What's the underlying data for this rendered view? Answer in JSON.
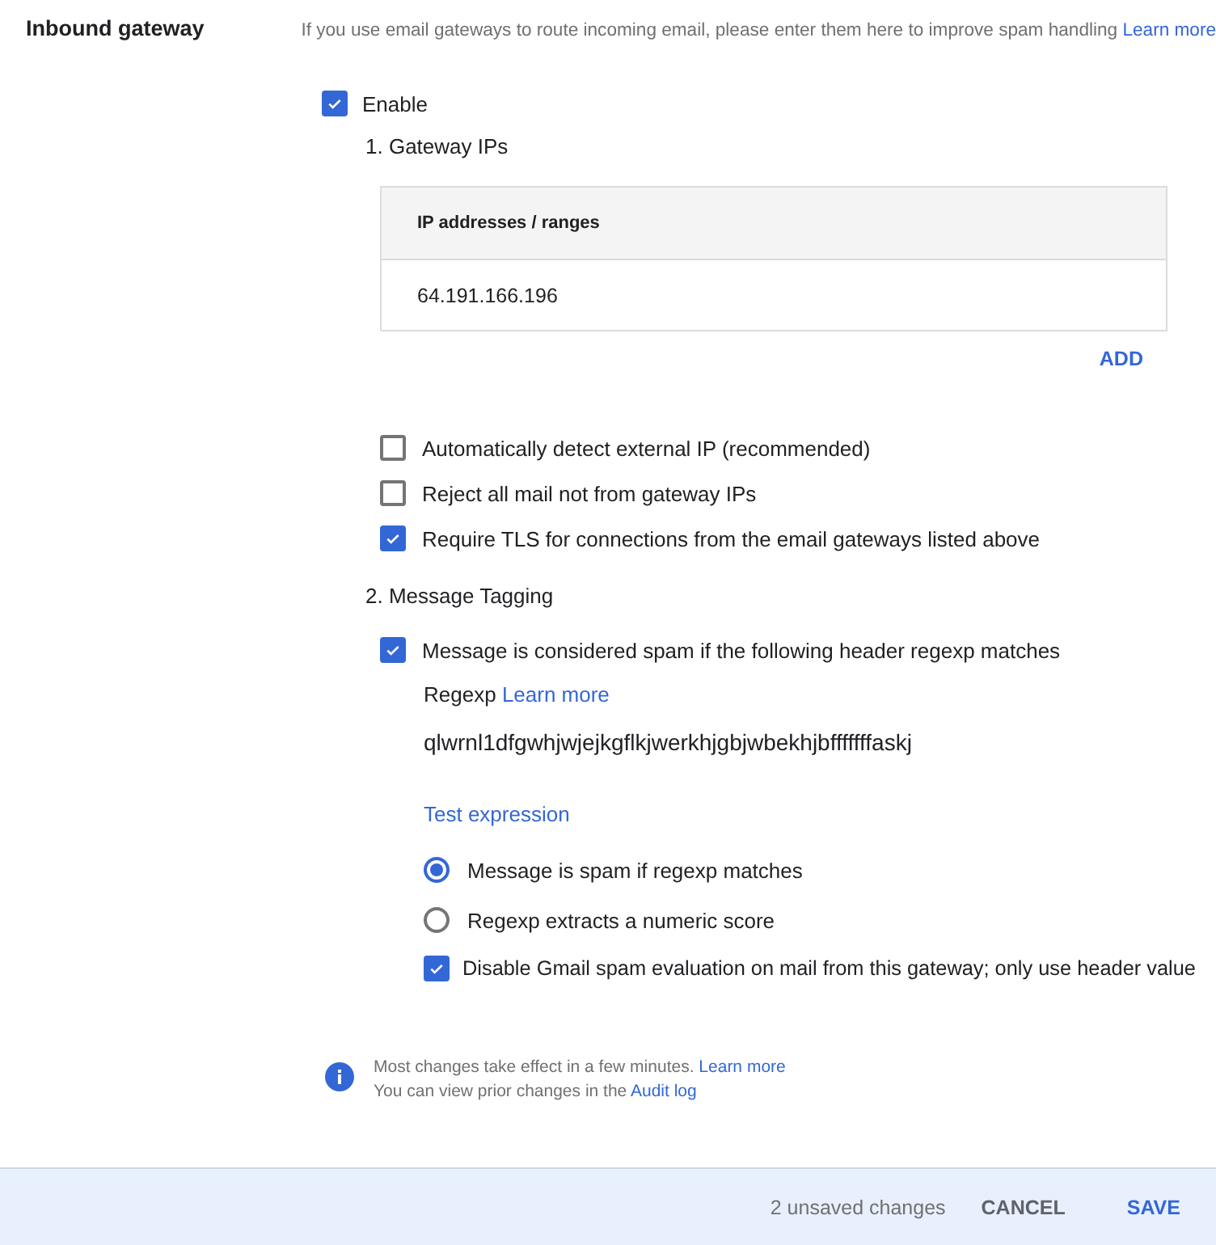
{
  "section": {
    "title": "Inbound gateway",
    "description": "If you use email gateways to route incoming email, please enter them here to improve spam handling",
    "description_link": "Learn more"
  },
  "enable": {
    "label": "Enable",
    "checked": true
  },
  "gateway_ips": {
    "heading": "1. Gateway IPs",
    "table": {
      "columns": [
        "IP addresses / ranges"
      ],
      "rows": [
        [
          "64.191.166.196"
        ]
      ]
    },
    "add_button": "ADD"
  },
  "options": [
    {
      "label": "Automatically detect external IP (recommended)",
      "checked": false
    },
    {
      "label": "Reject all mail not from gateway IPs",
      "checked": false
    },
    {
      "label": "Require TLS for connections from the email gateways listed above",
      "checked": true
    }
  ],
  "message_tagging": {
    "heading": "2. Message Tagging",
    "spam_rule": {
      "label": "Message is considered spam if the following header regexp matches",
      "checked": true
    },
    "regexp_label": "Regexp",
    "regexp_link": "Learn more",
    "regexp_value": "qlwrnl1dfgwhjwjejkgflkjwerkhjgbjwbekhjbfffffffaskj",
    "test_link": "Test expression",
    "modes": [
      {
        "label": "Message is spam if regexp matches",
        "selected": true
      },
      {
        "label": "Regexp extracts a numeric score",
        "selected": false
      }
    ],
    "disable_gmail": {
      "label": "Disable Gmail spam evaluation on mail from this gateway; only use header value",
      "checked": true
    }
  },
  "info": {
    "lines": [
      {
        "text": "Most changes take effect in a few minutes.",
        "link": "Learn more"
      },
      {
        "text": "You can view prior changes in the",
        "link": "Audit log"
      }
    ]
  },
  "footer": {
    "status": "2 unsaved changes",
    "cancel": "CANCEL",
    "save": "SAVE"
  }
}
